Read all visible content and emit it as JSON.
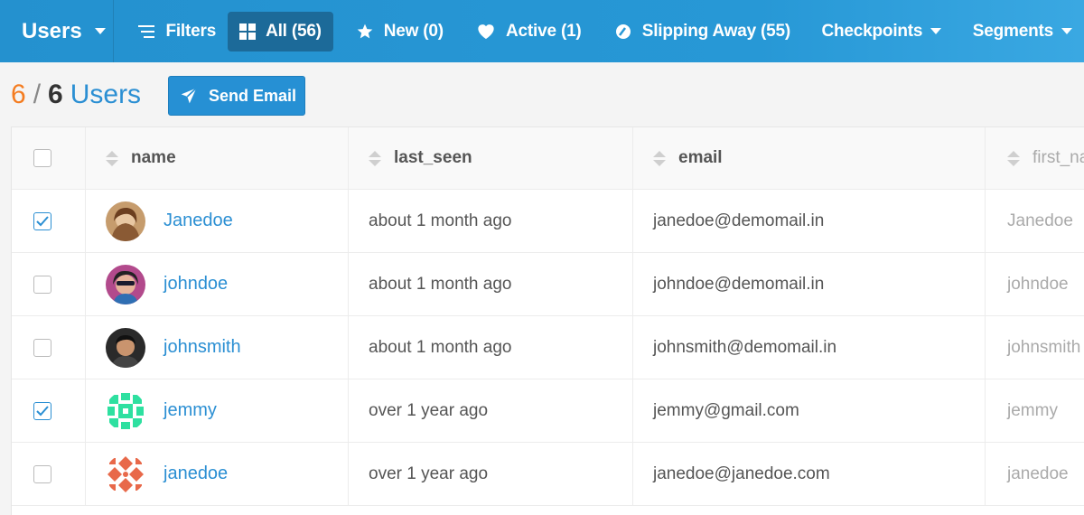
{
  "topbar": {
    "brand": "Users",
    "items": [
      {
        "label": "Filters",
        "icon": "filter-icon",
        "active": false
      },
      {
        "label": "All (56)",
        "icon": "grid-icon",
        "active": true
      },
      {
        "label": "New (0)",
        "icon": "star-icon",
        "active": false
      },
      {
        "label": "Active (1)",
        "icon": "heart-icon",
        "active": false
      },
      {
        "label": "Slipping Away (55)",
        "icon": "slipping-icon",
        "active": false
      },
      {
        "label": "Checkpoints",
        "icon": "chevron-down-icon",
        "active": false
      },
      {
        "label": "Segments",
        "icon": "chevron-down-icon",
        "active": false
      }
    ]
  },
  "toolbar": {
    "selected": "6",
    "separator": "/",
    "total": "6",
    "label": "Users",
    "send_label": "Send Email"
  },
  "table": {
    "columns": [
      "name",
      "last_seen",
      "email",
      "first_na"
    ],
    "rows": [
      {
        "checked": true,
        "name": "Janedoe",
        "last_seen": "about 1 month ago",
        "email": "janedoe@demomail.in",
        "first": "Janedoe"
      },
      {
        "checked": false,
        "name": "johndoe",
        "last_seen": "about 1 month ago",
        "email": "johndoe@demomail.in",
        "first": "johndoe"
      },
      {
        "checked": false,
        "name": "johnsmith",
        "last_seen": "about 1 month ago",
        "email": "johnsmith@demomail.in",
        "first": "johnsmith"
      },
      {
        "checked": true,
        "name": "jemmy",
        "last_seen": "over 1 year ago",
        "email": "jemmy@gmail.com",
        "first": "jemmy"
      },
      {
        "checked": false,
        "name": "janedoe",
        "last_seen": "over 1 year ago",
        "email": "janedoe@janedoe.com",
        "first": "janedoe"
      }
    ]
  },
  "colors": {
    "topbar": "#2798d6",
    "active_tab": "#1c6a99",
    "link": "#2b8fd3",
    "selected_count": "#f47c20"
  }
}
